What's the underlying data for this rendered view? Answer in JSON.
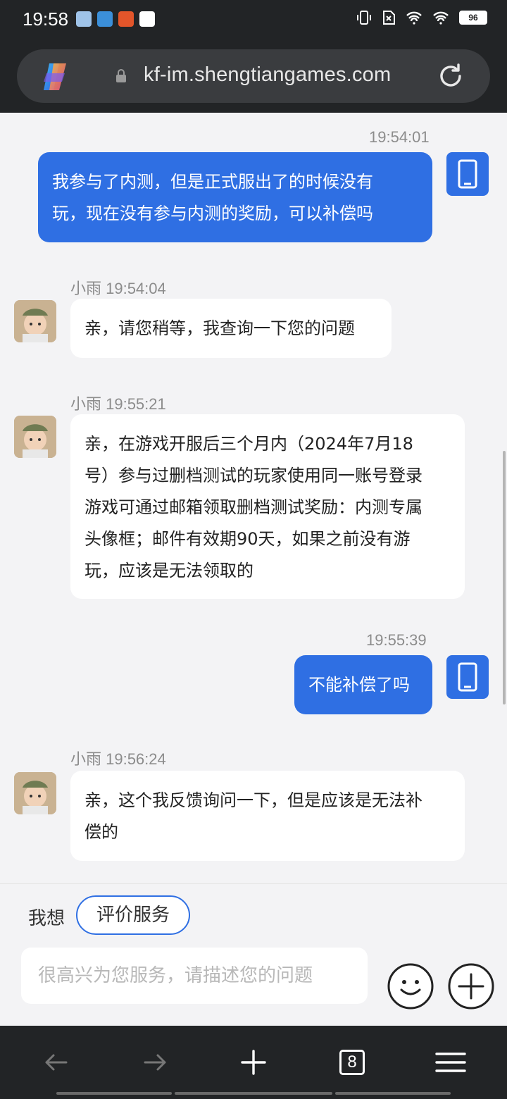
{
  "status_bar": {
    "time": "19:58",
    "battery": "96"
  },
  "browser": {
    "url": "kf-im.shengtiangames.com",
    "tab_count": "8"
  },
  "messages": [
    {
      "sender": "user",
      "time": "19:54:01",
      "lines": [
        "我参与了内测，但是正式服出了的时候没有",
        "玩，现在没有参与内测的奖励，可以补偿吗"
      ]
    },
    {
      "sender": "agent",
      "header": "小雨 19:54:04",
      "lines": [
        "亲，请您稍等，我查询一下您的问题"
      ]
    },
    {
      "sender": "agent",
      "header": "小雨 19:55:21",
      "lines": [
        "亲，在游戏开服后三个月内（2024年7月18",
        "号）参与过删档测试的玩家使用同一账号登录",
        "游戏可通过邮箱领取删档测试奖励：内测专属",
        "头像框；邮件有效期90天，如果之前没有游",
        "玩，应该是无法领取的"
      ]
    },
    {
      "sender": "user",
      "time": "19:55:39",
      "lines": [
        "不能补偿了吗"
      ]
    },
    {
      "sender": "agent",
      "header": "小雨 19:56:24",
      "lines": [
        "亲，这个我反馈询问一下，但是应该是无法补",
        "偿的"
      ]
    }
  ],
  "input_area": {
    "want_label": "我想",
    "rate_button": "评价服务",
    "placeholder": "很高兴为您服务，请描述您的问题"
  },
  "colors": {
    "accent": "#2f6fe3",
    "header_bg": "#222426",
    "chat_bg": "#f3f3f5"
  }
}
